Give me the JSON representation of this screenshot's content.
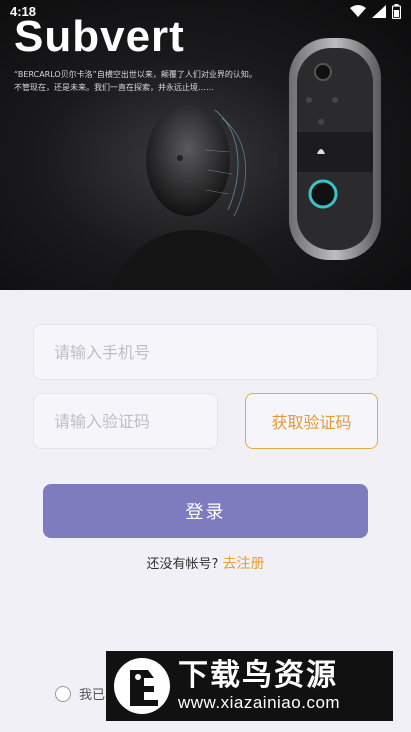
{
  "status_bar": {
    "time": "4:18"
  },
  "hero": {
    "brand": "Subvert",
    "tagline_1": "“BERCARLO贝尔卡洛”自横空出世以来，颠覆了人们对业界的认知。",
    "tagline_2": "不管现在，还是未来。我们一直在探索，并永远止境……"
  },
  "form": {
    "phone_placeholder": "请输入手机号",
    "code_placeholder": "请输入验证码",
    "get_code_label": "获取验证码",
    "login_label": "登录",
    "no_account_text": "还没有帐号?",
    "register_link": "去注册",
    "agree_text": "我已"
  },
  "watermark": {
    "title": "下载鸟资源",
    "url": "www.xiazainiao.com"
  },
  "colors": {
    "accent_orange": "#e6a033",
    "login_purple": "#7e7bbf",
    "background": "#f0f0f6"
  }
}
